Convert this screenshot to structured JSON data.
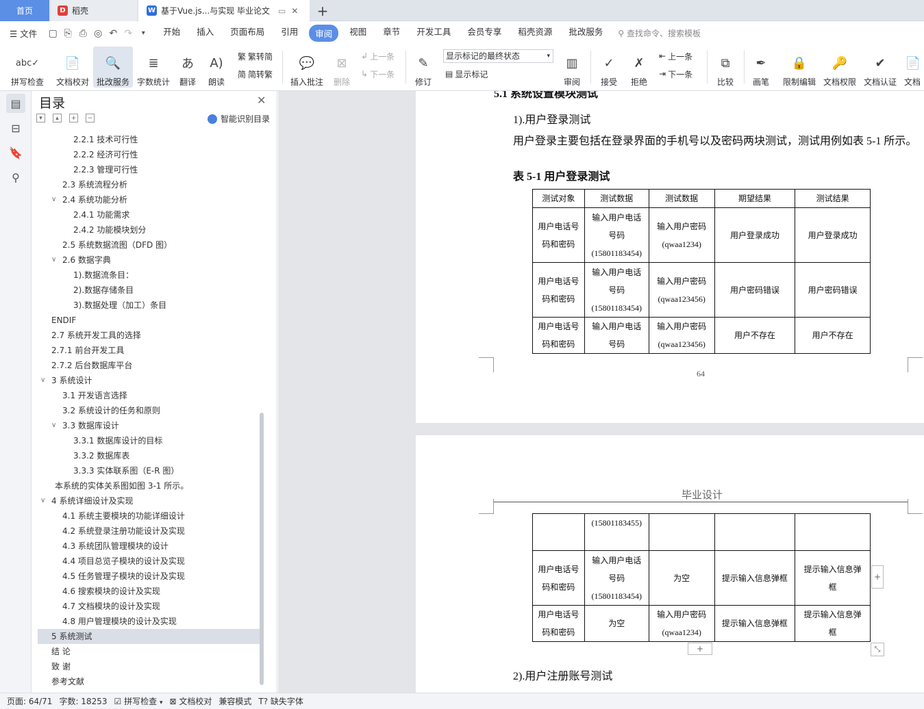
{
  "tabs": {
    "home": "首页",
    "daoke": "稻壳",
    "doc": "基于Vue.js...与实现 毕业论文"
  },
  "menu": {
    "file": "文件",
    "items": [
      "开始",
      "插入",
      "页面布局",
      "引用",
      "审阅",
      "视图",
      "章节",
      "开发工具",
      "会员专享",
      "稻壳资源",
      "批改服务"
    ],
    "active": "审阅",
    "search": "查找命令、搜索模板"
  },
  "ribbon": {
    "spell": "拼写检查",
    "proof": "文档校对",
    "revise_service": "批改服务",
    "word_count": "字数统计",
    "translate": "翻译",
    "read": "朗读",
    "trad": "繁转简",
    "simp": "简转繁",
    "insert_comment": "插入批注",
    "delete": "删除",
    "prev": "上一条",
    "next": "下一条",
    "track": "修订",
    "mark_state": "显示标记的最终状态",
    "show_marks": "显示标记",
    "review": "审阅",
    "accept": "接受",
    "reject": "拒绝",
    "prev2": "上一条",
    "next2": "下一条",
    "compare": "比较",
    "pen": "画笔",
    "restrict": "限制编辑",
    "perm": "文档权限",
    "cert": "文档认证",
    "more": "文档"
  },
  "toc": {
    "title": "目录",
    "smart": "智能识别目录",
    "items": [
      {
        "t": "2.2.1  技术可行性",
        "l": 3
      },
      {
        "t": "2.2.2  经济可行性",
        "l": 3
      },
      {
        "t": "2.2.3  管理可行性",
        "l": 3
      },
      {
        "t": "2.3  系统流程分析",
        "l": 2
      },
      {
        "t": "2.4  系统功能分析",
        "l": 2,
        "e": 1
      },
      {
        "t": "2.4.1  功能需求",
        "l": 3
      },
      {
        "t": "2.4.2  功能模块划分",
        "l": 3
      },
      {
        "t": "2.5  系统数据流图（DFD 图）",
        "l": 2
      },
      {
        "t": "2.6 数据字典",
        "l": 2,
        "e": 1
      },
      {
        "t": "1).数据流条目：",
        "l": 3
      },
      {
        "t": "2).数据存储条目",
        "l": 3
      },
      {
        "t": "3).数据处理（加工）条目",
        "l": 3
      },
      {
        "t": "ENDIF",
        "l": 1
      },
      {
        "t": "2.7  系统开发工具的选择",
        "l": 1
      },
      {
        "t": "2.7.1  前台开发工具",
        "l": 1
      },
      {
        "t": "2.7.2  后台数据库平台",
        "l": 1
      },
      {
        "t": "3  系统设计",
        "l": 1,
        "e": 1
      },
      {
        "t": "3.1  开发语言选择",
        "l": 2
      },
      {
        "t": "3.2  系统设计的任务和原则",
        "l": 2
      },
      {
        "t": "3.3  数据库设计",
        "l": 2,
        "e": 1
      },
      {
        "t": "3.3.1  数据库设计的目标",
        "l": 3
      },
      {
        "t": "3.3.2  数据库表",
        "l": 3
      },
      {
        "t": "3.3.3  实体联系图（E-R 图）",
        "l": 3
      },
      {
        "t": "本系统的实体关系图如图 3-1 所示。",
        "l": 1.3
      },
      {
        "t": "4  系统详细设计及实现",
        "l": 1,
        "e": 1
      },
      {
        "t": "4.1 系统主要模块的功能详细设计",
        "l": 2
      },
      {
        "t": "4.2  系统登录注册功能设计及实现",
        "l": 2
      },
      {
        "t": "4.3  系统团队管理模块的设计",
        "l": 2
      },
      {
        "t": "4.4  项目总览子模块的设计及实现",
        "l": 2
      },
      {
        "t": "4.5  任务管理子模块的设计及实现",
        "l": 2
      },
      {
        "t": "4.6  搜索模块的设计及实现",
        "l": 2
      },
      {
        "t": "4.7  文档模块的设计及实现",
        "l": 2
      },
      {
        "t": "4.8  用户管理模块的设计及实现",
        "l": 2
      },
      {
        "t": "5  系统测试",
        "l": 1,
        "sel": 1
      },
      {
        "t": "结    论",
        "l": 1
      },
      {
        "t": "致    谢",
        "l": 1
      },
      {
        "t": "参考文献",
        "l": 1
      }
    ]
  },
  "doc": {
    "heading": "5.1  系统设置模块测试",
    "sub1": "1).用户登录测试",
    "para1": "用户登录主要包括在登录界面的手机号以及密码两块测试，测试用例如表 5-1 所示。",
    "caption": "表 5-1    用户登录测试",
    "headers": [
      "测试对象",
      "测试数据",
      "测试数据",
      "期望结果",
      "测试结果"
    ],
    "rows1": [
      [
        "用户电话号\n码和密码",
        "输入用户电话\n号码\n(15801183454)",
        "输入用户密码\n(qwaa1234)",
        "用户登录成功",
        "用户登录成功"
      ],
      [
        "用户电话号\n码和密码",
        "输入用户电话\n号码\n(15801183454)",
        "输入用户密码\n(qwaa123456)",
        "用户密码错误",
        "用户密码错误"
      ],
      [
        "用户电话号\n码和密码",
        "输入用户电话\n号码",
        "输入用户密码\n(qwaa123456)",
        "用户不存在",
        "用户不存在"
      ]
    ],
    "page_num": "64",
    "header2": "毕业设计",
    "rows2": [
      [
        "",
        "(15801183455)",
        "",
        "",
        ""
      ],
      [
        "用户电话号\n码和密码",
        "输入用户电话\n号码\n(15801183454)",
        "为空",
        "提示输入信息弹框",
        "提示输入信息弹\n框"
      ],
      [
        "用户电话号\n码和密码",
        "为空",
        "输入用户密码\n(qwaa1234)",
        "提示输入信息弹框",
        "提示输入信息弹\n框"
      ]
    ],
    "sub2": "2).用户注册账号测试"
  },
  "status": {
    "page": "页面: 64/71",
    "words": "字数: 18253",
    "spell": "拼写检查",
    "proof": "文档校对",
    "compat": "兼容模式",
    "font": "缺失字体"
  }
}
